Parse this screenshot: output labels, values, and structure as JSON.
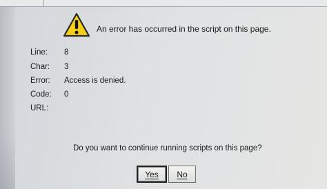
{
  "dialog": {
    "message": "An error has occurred in the script on this page.",
    "icon": "warning-icon",
    "details": [
      {
        "label": "Line:",
        "value": "8"
      },
      {
        "label": "Char:",
        "value": "3"
      },
      {
        "label": "Error:",
        "value": "Access is denied."
      },
      {
        "label": "Code:",
        "value": "0"
      },
      {
        "label": "URL:",
        "value": ""
      }
    ],
    "question": "Do you want to continue running scripts on this page?",
    "yes_label": "Yes",
    "no_label": "No"
  },
  "colors": {
    "icon_fill": "#f5d017",
    "icon_outline": "#2a2a2a",
    "background": "#dcdee1"
  }
}
